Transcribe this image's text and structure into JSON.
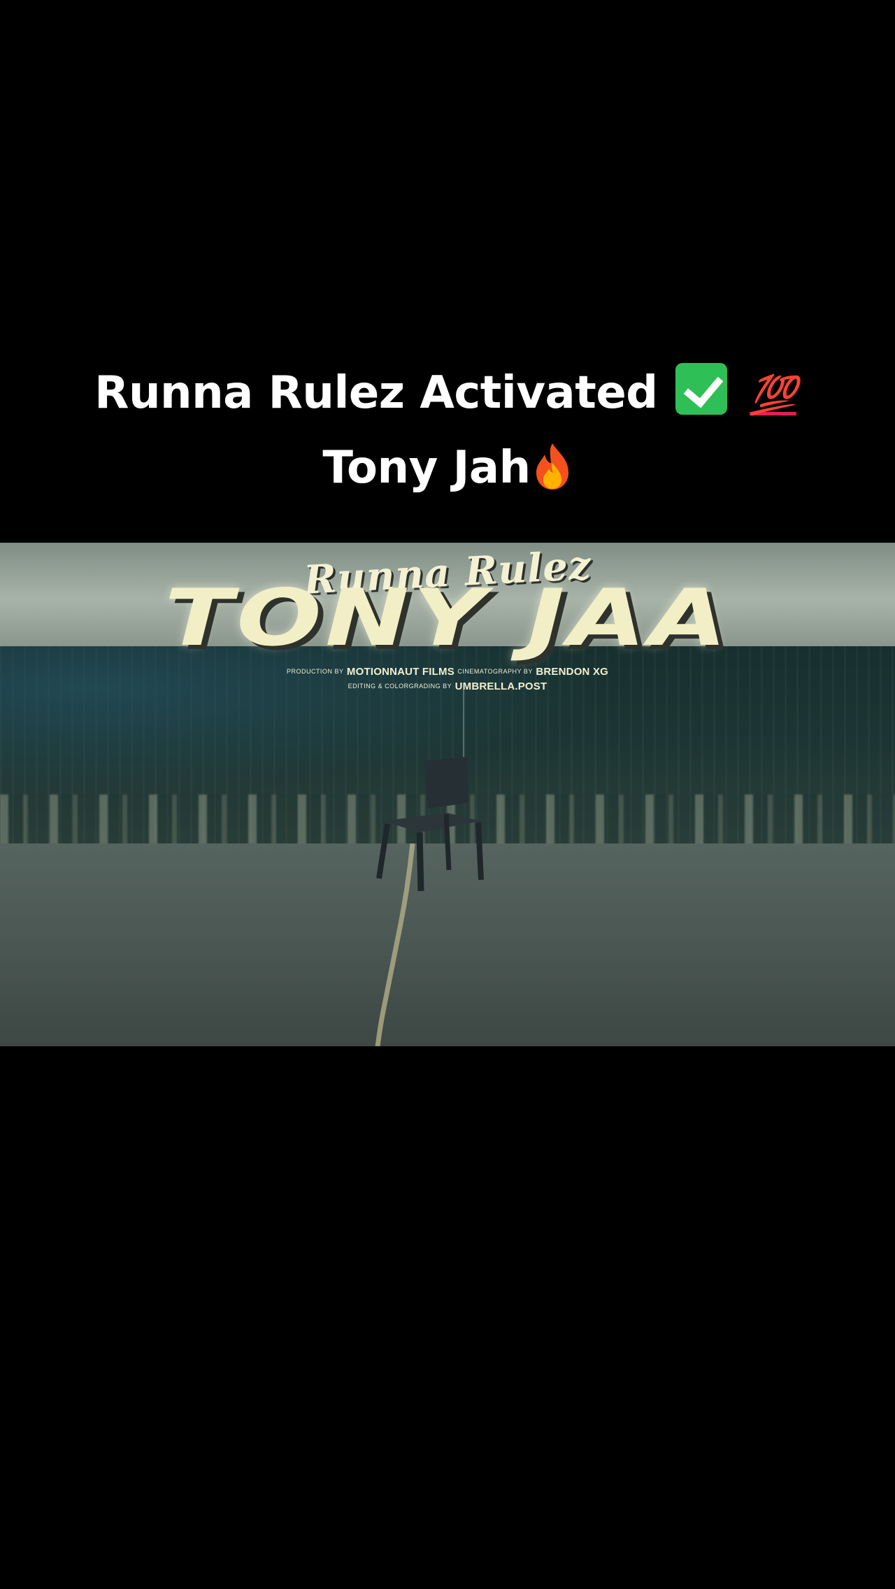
{
  "caption": {
    "text_before": "Runna Rulez Activated",
    "emoji_check": "check-mark-button-emoji",
    "emoji_100": "💯",
    "text_after": "Tony Jah",
    "emoji_fire": "fire-emoji"
  },
  "video": {
    "title_script": "Runna Rulez",
    "title_main": "TONY JAA",
    "credits": {
      "production_label": "PRODUCTION BY",
      "production_value": "MOTIONNAUT FILMS",
      "cinematography_label": "CINEMATOGRAPHY BY",
      "cinematography_value": "BRENDON XG",
      "editing_label": "EDITING & COLORGRADING BY",
      "editing_value": "UMBRELLA.POST"
    }
  },
  "colors": {
    "background": "#000000",
    "caption_text": "#ffffff",
    "title_text": "#f2efc6"
  }
}
